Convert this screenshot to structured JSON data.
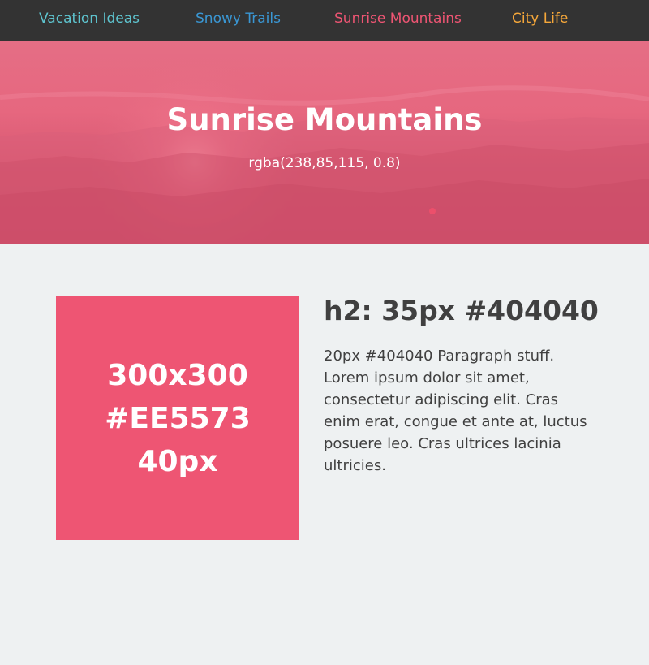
{
  "nav": {
    "items": [
      {
        "label": "Vacation Ideas",
        "color": "#5ec4cf"
      },
      {
        "label": "Snowy Trails",
        "color": "#3a97d4"
      },
      {
        "label": "Sunrise Mountains",
        "color": "#ee5573"
      },
      {
        "label": "City Life",
        "color": "#f5a73a"
      }
    ]
  },
  "hero": {
    "title": "Sunrise Mountains",
    "subtitle": "rgba(238,85,115, 0.8)",
    "overlay_color": "rgba(238,85,115,0.8)"
  },
  "content": {
    "square": {
      "lines": [
        "300x300",
        "#EE5573",
        "40px"
      ],
      "color": "#EE5573"
    },
    "heading": "h2: 35px #404040",
    "paragraph": "20px #404040 Paragraph stuff. Lorem ipsum dolor sit amet, consectetur adipiscing elit. Cras enim erat, congue et ante at, luctus posuere leo. Cras ultrices lacinia ultricies."
  }
}
